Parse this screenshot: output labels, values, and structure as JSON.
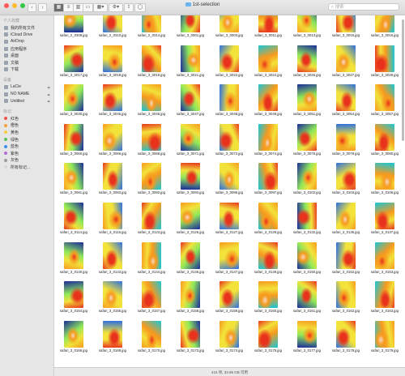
{
  "window": {
    "title": "1st-selection",
    "search_placeholder": "搜索",
    "status_text": "416 项, 33.96 GB 可用",
    "traffic_lights": [
      "#fc5b57",
      "#fdbc2e",
      "#33c748"
    ]
  },
  "toolbar": {
    "back_icon": "chevron-left-icon",
    "forward_icon": "chevron-right-icon",
    "views": [
      "icon-view-icon",
      "list-view-icon",
      "column-view-icon",
      "gallery-view-icon"
    ],
    "active_view": 0,
    "arrange_icon": "arrange-grid-icon",
    "action_icon": "gear-icon",
    "share_icon": "share-icon",
    "tag_icon": "tag-icon"
  },
  "sidebar": {
    "favorites_header": "个人收藏",
    "favorites": [
      {
        "label": "我的所有文件",
        "icon": "all-files-icon"
      },
      {
        "label": "iCloud Drive",
        "icon": "cloud-icon"
      },
      {
        "label": "AirDrop",
        "icon": "airdrop-icon"
      },
      {
        "label": "应用程序",
        "icon": "applications-icon"
      },
      {
        "label": "桌面",
        "icon": "desktop-icon"
      },
      {
        "label": "文稿",
        "icon": "documents-icon"
      },
      {
        "label": "下载",
        "icon": "downloads-icon"
      }
    ],
    "devices_header": "设备",
    "devices": [
      {
        "label": "LaCie",
        "icon": "drive-icon"
      },
      {
        "label": "NO NAME",
        "icon": "drive-icon"
      },
      {
        "label": "Untitled",
        "icon": "drive-icon"
      }
    ],
    "tags_header": "标记",
    "tags": [
      {
        "label": "红色",
        "color": "#f2514c"
      },
      {
        "label": "橙色",
        "color": "#f7a03b"
      },
      {
        "label": "黄色",
        "color": "#f5cf3d"
      },
      {
        "label": "绿色",
        "color": "#5ac05a"
      },
      {
        "label": "蓝色",
        "color": "#3c8ef0"
      },
      {
        "label": "紫色",
        "color": "#b56fd4"
      },
      {
        "label": "灰色",
        "color": "#9a9a9a"
      },
      {
        "label": "所有标记...",
        "color": "#d8d8d8"
      }
    ]
  },
  "files": [
    "safari_2_0309.jpg",
    "safari_2_0310.jpg",
    "safari_2_0314.jpg",
    "safari_3_0001.jpg",
    "safari_3_0003.jpg",
    "safari_3_0011.jpg",
    "safari_3_0013.jpg",
    "safari_3_0015.jpg",
    "safari_3_0016.jpg",
    "safari_3_0017.jpg",
    "safari_3_0018.jpg",
    "safari_3_0019.jpg",
    "safari_3_0021.jpg",
    "safari_3_0022.jpg",
    "safari_3_0024.jpg",
    "safari_3_0026.jpg",
    "safari_3_0027.jpg",
    "safari_3_0029.jpg",
    "safari_3_0030.jpg",
    "safari_3_0045.jpg",
    "safari_3_0046.jpg",
    "safari_3_0047.jpg",
    "safari_3_0048.jpg",
    "safari_3_0049.jpg",
    "safari_3_0051.jpg",
    "safari_3_0054.jpg",
    "safari_3_0057.jpg",
    "safari_3_0060.jpg",
    "safari_3_0066.jpg",
    "safari_3_0068.jpg",
    "safari_3_0071.jpg",
    "safari_3_0072.jpg",
    "safari_3_0074.jpg",
    "safari_3_0076.jpg",
    "safari_3_0079.jpg",
    "safari_3_0080.jpg",
    "safari_3_0081.jpg",
    "safari_3_0083.jpg",
    "safari_3_0092.jpg",
    "safari_3_0093.jpg",
    "safari_3_0096.jpg",
    "safari_3_0097.jpg",
    "safari_3_0102.jpg",
    "safari_3_0103.jpg",
    "safari_3_0106.jpg",
    "safari_3_0114.jpg",
    "safari_3_0115.jpg",
    "safari_3_0123.jpg",
    "safari_3_0126.jpg",
    "safari_3_0127.jpg",
    "safari_3_0129.jpg",
    "safari_3_0132.jpg",
    "safari_3_0135.jpg",
    "safari_3_0137.jpg",
    "safari_3_0140.jpg",
    "safari_3_0143.jpg",
    "safari_3_0144.jpg",
    "safari_3_0146.jpg",
    "safari_3_0147.jpg",
    "safari_3_0149.jpg",
    "safari_3_0150.jpg",
    "safari_3_0152.jpg",
    "safari_3_0153.jpg",
    "safari_3_0154.jpg",
    "safari_3_0156.jpg",
    "safari_3_0157.jpg",
    "safari_3_0158.jpg",
    "safari_3_0159.jpg",
    "safari_3_0160.jpg",
    "safari_3_0161.jpg",
    "safari_3_0162.jpg",
    "safari_3_0163.jpg",
    "safari_3_0166.jpg",
    "safari_3_0169.jpg",
    "safari_3_0170.jpg",
    "safari_3_0173.jpg",
    "safari_3_0174.jpg",
    "safari_3_0175.jpg",
    "safari_3_0177.jpg",
    "safari_3_0178.jpg",
    "safari_3_0179.jpg"
  ],
  "thumbnail_colors": [
    "#1a2a9a",
    "#2b6fe0",
    "#16c7d9",
    "#8fe85a",
    "#f2e23a",
    "#f79a1e",
    "#e8321c",
    "#f7d9c4"
  ]
}
